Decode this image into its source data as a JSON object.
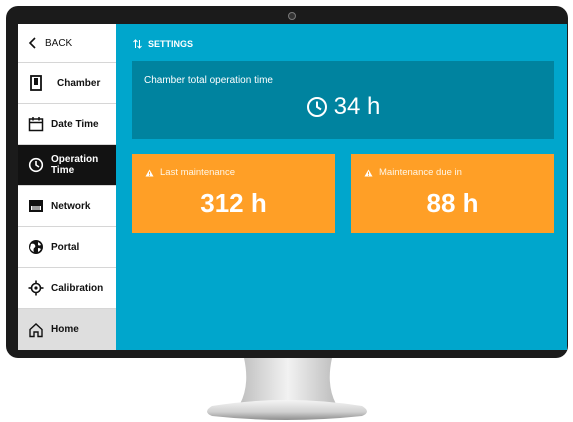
{
  "sidebar": {
    "back_label": "BACK",
    "items": [
      {
        "label": "Chamber",
        "icon": "chamber-icon"
      },
      {
        "label": "Date Time",
        "icon": "calendar-icon"
      },
      {
        "label_line1": "Operation",
        "label_line2": "Time",
        "icon": "clock-icon",
        "active": true
      },
      {
        "label": "Network",
        "icon": "network-icon"
      },
      {
        "label": "Portal",
        "icon": "globe-icon"
      },
      {
        "label": "Calibration",
        "icon": "crosshair-icon"
      },
      {
        "label": "Home",
        "icon": "home-icon"
      }
    ]
  },
  "header": {
    "breadcrumb": "SETTINGS",
    "breadcrumb_icon": "sort-arrows-icon"
  },
  "total": {
    "title": "Chamber total operation time",
    "value": "34 h"
  },
  "last_maintenance": {
    "title": "Last maintenance",
    "value": "312 h"
  },
  "maintenance_due": {
    "title": "Maintenance due in",
    "value": "88 h"
  },
  "colors": {
    "screen_bg": "#00a6cc",
    "card_dark": "#00839f",
    "card_orange": "#ff9f26",
    "sidebar_active": "#121212"
  }
}
